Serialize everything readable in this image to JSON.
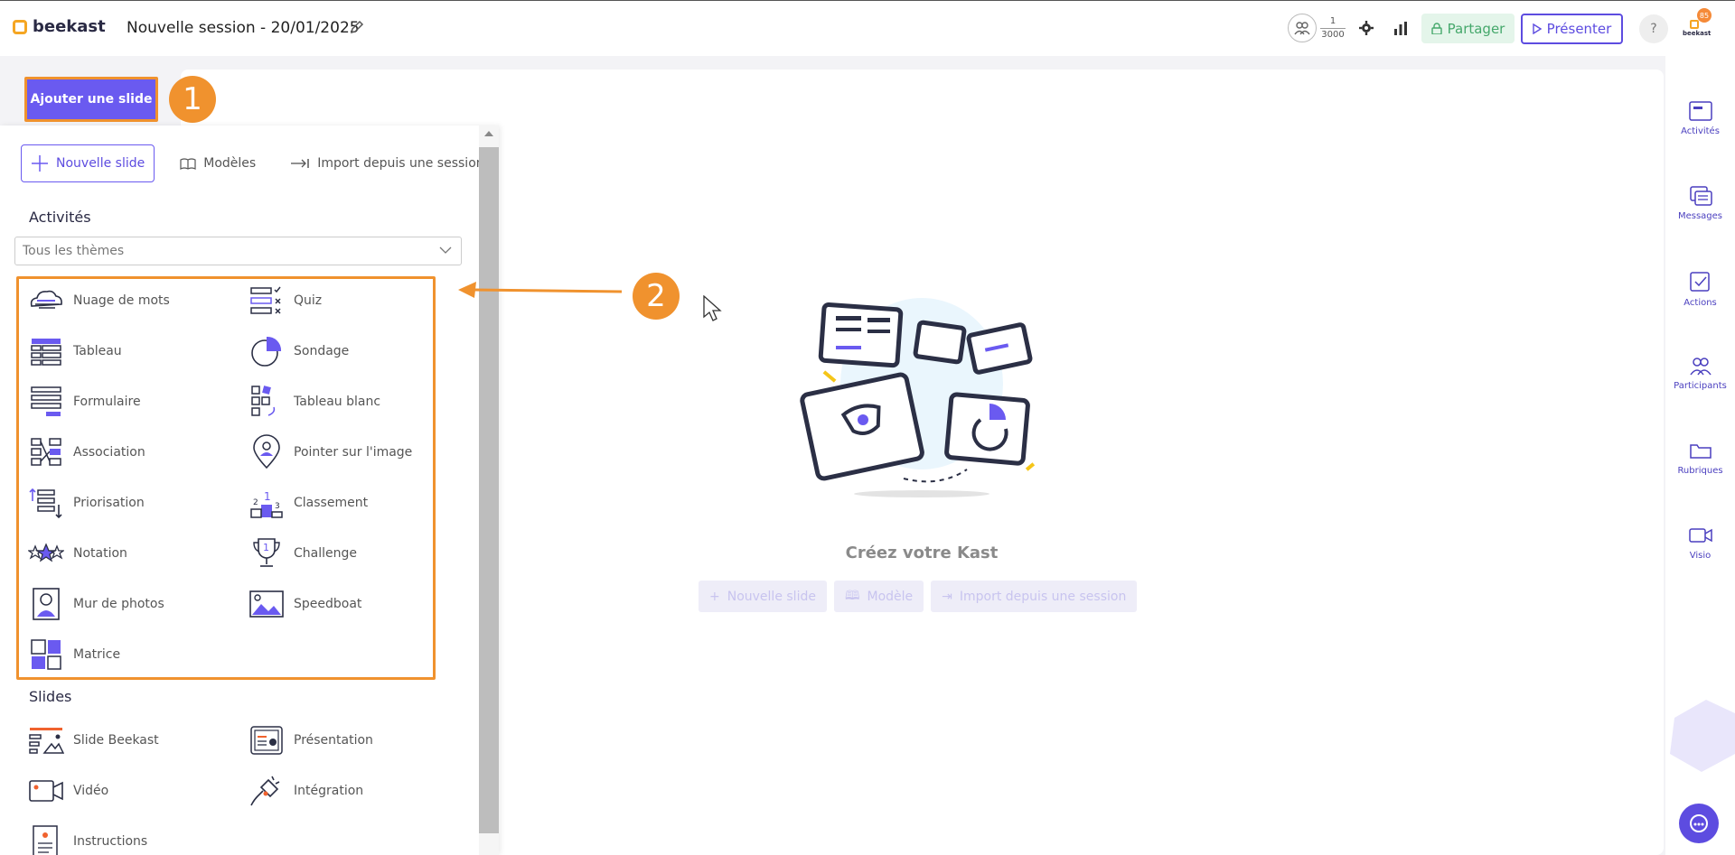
{
  "app": {
    "logo_text": "beekast",
    "session_title": "Nouvelle session - 20/01/2025",
    "participants_current": "1",
    "participants_max": "3000",
    "share_label": "Partager",
    "present_label": "Présenter",
    "help_label": "?",
    "avatar_badge": "85",
    "avatar_label": "beekast"
  },
  "callouts": {
    "step1": "1",
    "step2": "2"
  },
  "add_slide_label": "Ajouter une slide",
  "panel": {
    "tabs": [
      "Nouvelle slide",
      "Modèles",
      "Import depuis une session"
    ],
    "activities_title": "Activités",
    "theme_select_value": "Tous les thèmes",
    "activities": [
      "Nuage de mots",
      "Quiz",
      "Tableau",
      "Sondage",
      "Formulaire",
      "Tableau blanc",
      "Association",
      "Pointer sur l'image",
      "Priorisation",
      "Classement",
      "Notation",
      "Challenge",
      "Mur de photos",
      "Speedboat",
      "Matrice"
    ],
    "slides_title": "Slides",
    "slides": [
      "Slide Beekast",
      "Présentation",
      "Vidéo",
      "Intégration",
      "Instructions"
    ]
  },
  "canvas": {
    "empty_title": "Créez votre Kast",
    "cta": [
      "Nouvelle slide",
      "Modèle",
      "Import depuis une session"
    ]
  },
  "right_sidebar": [
    "Activités",
    "Messages",
    "Actions",
    "Participants",
    "Rubriques",
    "Visio"
  ],
  "colors": {
    "accent": "#6a5af0",
    "callout": "#f0922e",
    "share_green": "#45a86b"
  }
}
